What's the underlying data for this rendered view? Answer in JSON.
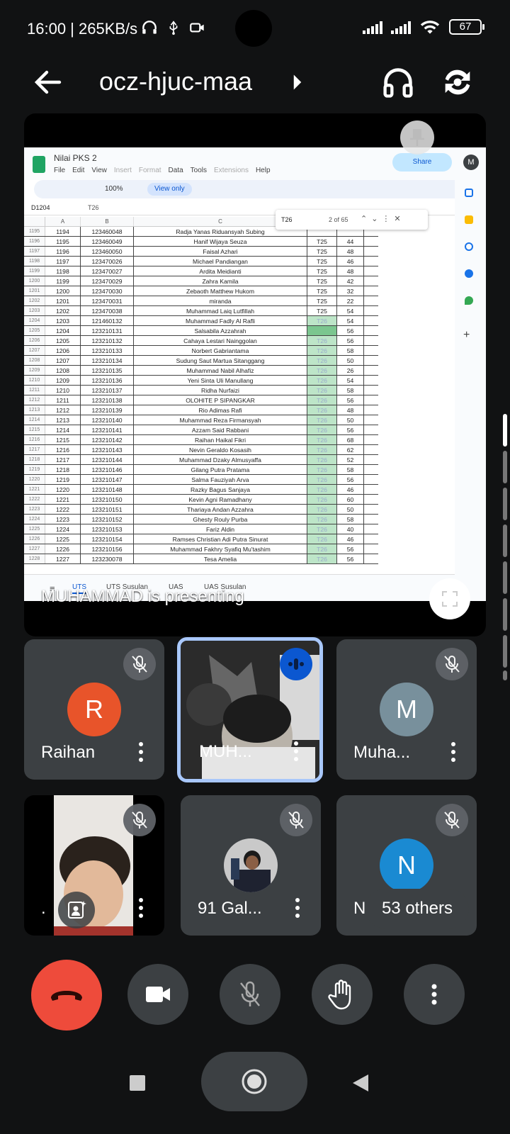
{
  "status_bar": {
    "time_speed": "16:00 | 265KB/s",
    "battery": "67",
    "icons": [
      "headphones-icon",
      "usb-icon",
      "video-icon",
      "signal-icon",
      "signal-icon",
      "wifi-icon",
      "battery-icon"
    ]
  },
  "meeting": {
    "code": "ocz-hjuc-maa",
    "presenting_text": "MUHAMMAD is presenting"
  },
  "sheet": {
    "title": "Nilai PKS 2",
    "menu": [
      "File",
      "Edit",
      "View",
      "Insert",
      "Format",
      "Data",
      "Tools",
      "Extensions",
      "Help"
    ],
    "share_label": "Share",
    "avatar": "M",
    "zoom": "100%",
    "view_only": "View only",
    "cell_ref": "D1204",
    "formula": "T26",
    "find": {
      "query": "T26",
      "count": "2 of 65"
    },
    "columns": [
      "A",
      "B",
      "C"
    ],
    "rows": [
      {
        "n": "1195",
        "a": "1194",
        "b": "123460048",
        "c": "Radja Yanas Riduansyah Subing",
        "d": "",
        "e": ""
      },
      {
        "n": "1196",
        "a": "1195",
        "b": "123460049",
        "c": "Hanif Wijaya Seuza",
        "d": "T25",
        "e": "44"
      },
      {
        "n": "1197",
        "a": "1196",
        "b": "123460050",
        "c": "Faisal Azhari",
        "d": "T25",
        "e": "48"
      },
      {
        "n": "1198",
        "a": "1197",
        "b": "123470026",
        "c": "Michael Pandiangan",
        "d": "T25",
        "e": "46"
      },
      {
        "n": "1199",
        "a": "1198",
        "b": "123470027",
        "c": "Ardita Meidianti",
        "d": "T25",
        "e": "48"
      },
      {
        "n": "1200",
        "a": "1199",
        "b": "123470029",
        "c": "Zahra Kamila",
        "d": "T25",
        "e": "42"
      },
      {
        "n": "1201",
        "a": "1200",
        "b": "123470030",
        "c": "Zebaoth Matthew Hukom",
        "d": "T25",
        "e": "32"
      },
      {
        "n": "1202",
        "a": "1201",
        "b": "123470031",
        "c": "miranda",
        "d": "T25",
        "e": "22"
      },
      {
        "n": "1203",
        "a": "1202",
        "b": "123470038",
        "c": "Muhammad Laiq Lutfillah",
        "d": "T25",
        "e": "54"
      },
      {
        "n": "1204",
        "a": "1203",
        "b": "121460132",
        "c": "Muhammad Fadly Al Rafli",
        "d": "T26",
        "e": "54"
      },
      {
        "n": "1205",
        "a": "1204",
        "b": "123210131",
        "c": "Salsabila Azzahrah",
        "d": "",
        "e": "56"
      },
      {
        "n": "1206",
        "a": "1205",
        "b": "123210132",
        "c": "Cahaya Lestari Nainggolan",
        "d": "T26",
        "e": "56"
      },
      {
        "n": "1207",
        "a": "1206",
        "b": "123210133",
        "c": "Norbert Gabriantama",
        "d": "T26",
        "e": "58"
      },
      {
        "n": "1208",
        "a": "1207",
        "b": "123210134",
        "c": "Sudung Saut Martua Sitanggang",
        "d": "T26",
        "e": "50"
      },
      {
        "n": "1209",
        "a": "1208",
        "b": "123210135",
        "c": "Muhammad Nabil Alhafiz",
        "d": "T26",
        "e": "26"
      },
      {
        "n": "1210",
        "a": "1209",
        "b": "123210136",
        "c": "Yeni Sinta Uli Manullang",
        "d": "T26",
        "e": "54"
      },
      {
        "n": "1211",
        "a": "1210",
        "b": "123210137",
        "c": "Ridha Nurfaizi",
        "d": "T26",
        "e": "58"
      },
      {
        "n": "1212",
        "a": "1211",
        "b": "123210138",
        "c": "OLOHITE P SIPANGKAR",
        "d": "T26",
        "e": "56"
      },
      {
        "n": "1213",
        "a": "1212",
        "b": "123210139",
        "c": "Rio Adimas Rafi",
        "d": "T26",
        "e": "48"
      },
      {
        "n": "1214",
        "a": "1213",
        "b": "123210140",
        "c": "Muhammad Reza Firmansyah",
        "d": "T26",
        "e": "50"
      },
      {
        "n": "1215",
        "a": "1214",
        "b": "123210141",
        "c": "Azzam Said Rabbani",
        "d": "T26",
        "e": "56"
      },
      {
        "n": "1216",
        "a": "1215",
        "b": "123210142",
        "c": "Raihan Haikal Fikri",
        "d": "T26",
        "e": "68"
      },
      {
        "n": "1217",
        "a": "1216",
        "b": "123210143",
        "c": "Nevin Geraldo Kosasih",
        "d": "T26",
        "e": "62"
      },
      {
        "n": "1218",
        "a": "1217",
        "b": "123210144",
        "c": "Muhammad Dzaky Almusyaffa",
        "d": "T26",
        "e": "52"
      },
      {
        "n": "1219",
        "a": "1218",
        "b": "123210146",
        "c": "Gilang Putra Pratama",
        "d": "T26",
        "e": "58"
      },
      {
        "n": "1220",
        "a": "1219",
        "b": "123210147",
        "c": "Salma Fauziyah Arva",
        "d": "T26",
        "e": "56"
      },
      {
        "n": "1221",
        "a": "1220",
        "b": "123210148",
        "c": "Razky Bagus Sanjaya",
        "d": "T26",
        "e": "46"
      },
      {
        "n": "1222",
        "a": "1221",
        "b": "123210150",
        "c": "Kevin Agni Ramadhany",
        "d": "T26",
        "e": "60"
      },
      {
        "n": "1223",
        "a": "1222",
        "b": "123210151",
        "c": "Thariaya Andan Azzahra",
        "d": "T26",
        "e": "50"
      },
      {
        "n": "1224",
        "a": "1223",
        "b": "123210152",
        "c": "Ghesty Rouly Purba",
        "d": "T26",
        "e": "58"
      },
      {
        "n": "1225",
        "a": "1224",
        "b": "123210153",
        "c": "Fariz Aldin",
        "d": "T26",
        "e": "40"
      },
      {
        "n": "1226",
        "a": "1225",
        "b": "123210154",
        "c": "Ramses Christian Adi Putra Sinurat",
        "d": "T26",
        "e": "46"
      },
      {
        "n": "1227",
        "a": "1226",
        "b": "123210156",
        "c": "Muhammad Fakhry Syafiq Mu'tashim",
        "d": "T26",
        "e": "56"
      },
      {
        "n": "1228",
        "a": "1227",
        "b": "123230078",
        "c": "Tesa Amelia",
        "d": "T26",
        "e": "56"
      }
    ],
    "tabs": [
      "UTS",
      "UTS Susulan",
      "UAS",
      "UAS Susulan"
    ]
  },
  "participants": [
    {
      "name": "Raihan",
      "initial": "R",
      "avatar_color": "#e8542a"
    },
    {
      "name": "MUH..."
    },
    {
      "name": "Muha...",
      "initial": "M",
      "avatar_color": "#78909c"
    },
    {
      "name": "."
    },
    {
      "name": "91 Gal..."
    },
    {
      "name": "Ne...",
      "initial": "N",
      "avatar_color": "#1a8ad2"
    }
  ],
  "others_label": "53 others",
  "colors": {
    "end_call": "#ee4b3b",
    "tile_bg": "#3c4043",
    "speaking_border": "#a8c7fa"
  }
}
